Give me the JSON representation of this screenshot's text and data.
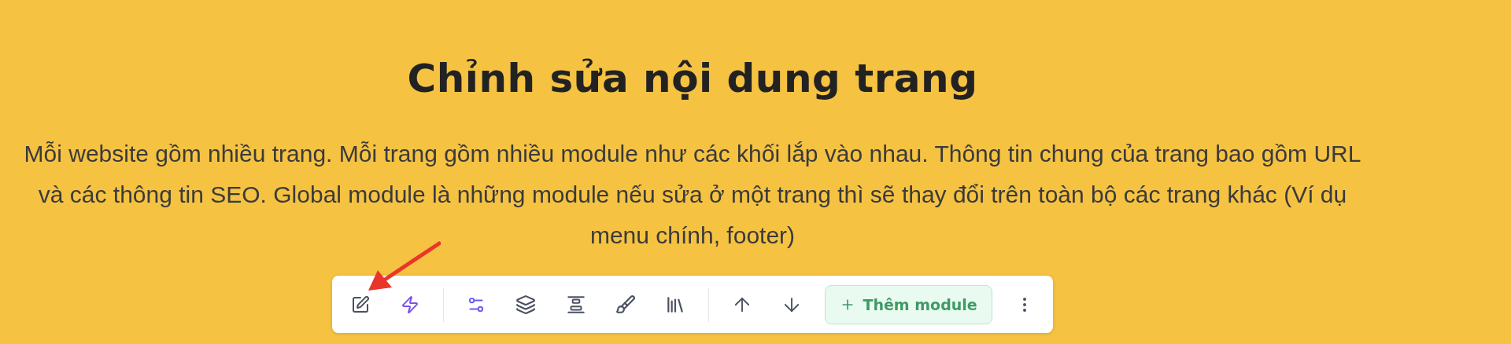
{
  "title": "Chỉnh sửa nội dung trang",
  "description": "Mỗi website gồm nhiều trang. Mỗi trang gồm nhiều module như các khối lắp vào nhau. Thông tin chung của trang bao gồm URL và các thông tin SEO. Global module là những module nếu sửa ở một trang thì sẽ thay đổi trên toàn bộ các trang khác (Ví dụ menu chính, footer)",
  "toolbar": {
    "add_button": "Thêm module"
  }
}
